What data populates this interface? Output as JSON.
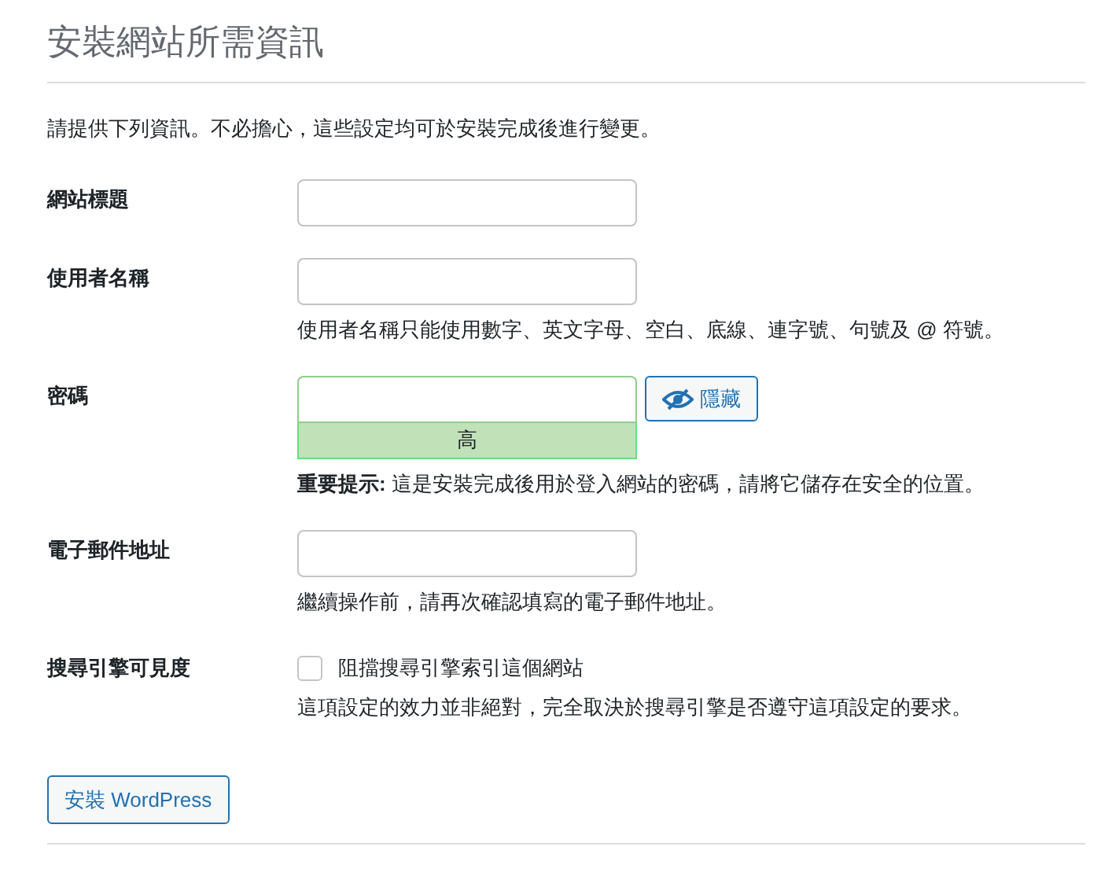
{
  "title": "安裝網站所需資訊",
  "intro": "請提供下列資訊。不必擔心，這些設定均可於安裝完成後進行變更。",
  "fields": [
    {
      "kind": "text",
      "label": "網站標題"
    },
    {
      "kind": "text",
      "label": "使用者名稱",
      "description": "使用者名稱只能使用數字、英文字母、空白、底線、連字號、句號及 @ 符號。"
    },
    {
      "kind": "password",
      "label": "密碼",
      "toggle": "隱藏",
      "strength": "高",
      "description": "**重要提示:** 這是安裝完成後用於登入網站的密碼，請將它儲存在安全的位置。"
    },
    {
      "kind": "text",
      "label": "電子郵件地址",
      "description": "繼續操作前，請再次確認填寫的電子郵件地址。"
    },
    {
      "kind": "checkbox",
      "label": "搜尋引擎可見度",
      "option": "阻擋搜尋引擎索引這個網站",
      "checked": false,
      "description": "這項設定的效力並非絕對，完全取決於搜尋引擎是否遵守這項設定的要求。"
    }
  ],
  "submit": "安裝 WordPress"
}
